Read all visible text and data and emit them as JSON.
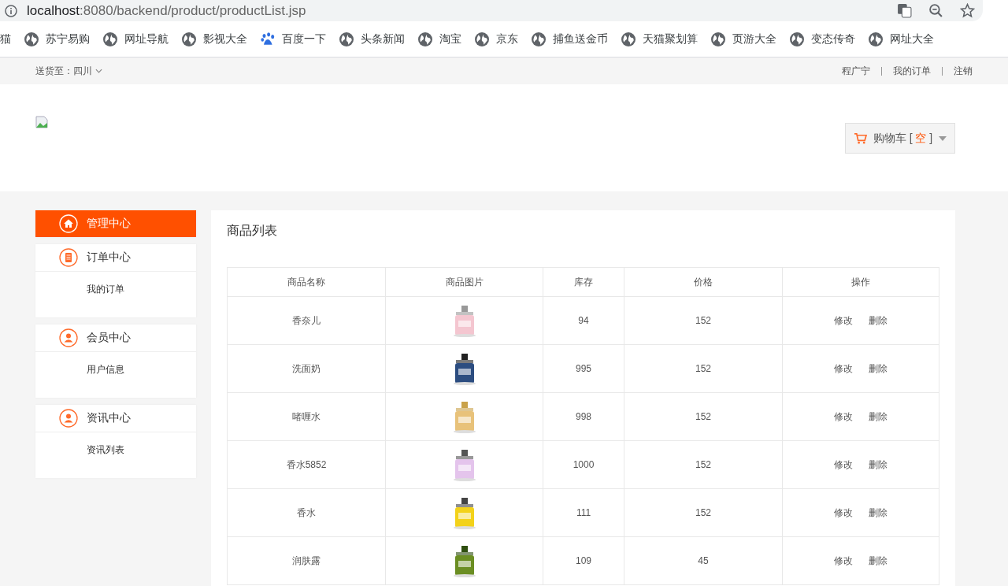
{
  "browser": {
    "url_host": "localhost",
    "url_path": ":8080/backend/product/productList.jsp",
    "bookmarks": [
      {
        "label": "猫",
        "kind": "plain"
      },
      {
        "label": "苏宁易购",
        "kind": "globe"
      },
      {
        "label": "网址导航",
        "kind": "globe"
      },
      {
        "label": "影视大全",
        "kind": "globe"
      },
      {
        "label": "百度一下",
        "kind": "paw"
      },
      {
        "label": "头条新闻",
        "kind": "globe"
      },
      {
        "label": "淘宝",
        "kind": "globe"
      },
      {
        "label": "京东",
        "kind": "globe"
      },
      {
        "label": "捕鱼送金币",
        "kind": "globe"
      },
      {
        "label": "天猫聚划算",
        "kind": "globe"
      },
      {
        "label": "页游大全",
        "kind": "globe"
      },
      {
        "label": "变态传奇",
        "kind": "globe"
      },
      {
        "label": "网址大全",
        "kind": "globe"
      }
    ]
  },
  "topbar": {
    "location": "送货至：四川",
    "links": [
      "程广宁",
      "我的订单",
      "注销"
    ]
  },
  "cart": {
    "label": "购物车",
    "open_bracket": "[",
    "status": "空",
    "close_bracket": "]"
  },
  "sidebar": [
    {
      "title": "管理中心",
      "kind": "home",
      "selected": true
    },
    {
      "title": "订单中心",
      "kind": "document",
      "selected": false,
      "items": [
        "我的订单"
      ]
    },
    {
      "title": "会员中心",
      "kind": "person",
      "selected": false,
      "items": [
        "用户信息"
      ]
    },
    {
      "title": "资讯中心",
      "kind": "person",
      "selected": false,
      "items": [
        "资讯列表"
      ]
    }
  ],
  "content": {
    "title": "商品列表",
    "columns": [
      "商品名称",
      "商品图片",
      "库存",
      "价格",
      "操作"
    ],
    "rows": [
      {
        "name": "香奈儿",
        "stock": "94",
        "price": "152",
        "actions": [
          "修改",
          "删除"
        ]
      },
      {
        "name": "洗面奶",
        "stock": "995",
        "price": "152",
        "actions": [
          "修改",
          "删除"
        ]
      },
      {
        "name": "啫喱水",
        "stock": "998",
        "price": "152",
        "actions": [
          "修改",
          "删除"
        ]
      },
      {
        "name": "香水5852",
        "stock": "1000",
        "price": "152",
        "actions": [
          "修改",
          "删除"
        ]
      },
      {
        "name": "香水",
        "stock": "111",
        "price": "152",
        "actions": [
          "修改",
          "删除"
        ]
      },
      {
        "name": "润肤露",
        "stock": "109",
        "price": "45",
        "actions": [
          "修改",
          "删除"
        ]
      }
    ]
  }
}
